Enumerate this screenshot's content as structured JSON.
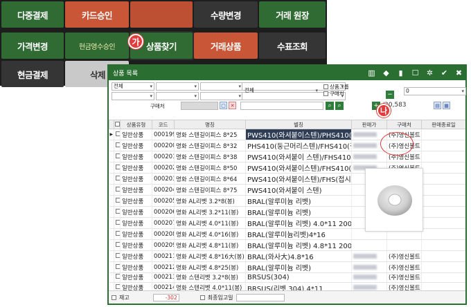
{
  "pos_buttons": [
    {
      "label": "다중결제"
    },
    {
      "label": "카드승인"
    },
    {
      "label": ""
    },
    {
      "label": "수량변경"
    },
    {
      "label": "거래 원장"
    },
    {
      "label": "가격변경"
    },
    {
      "label": "현금영수승인"
    },
    {
      "label": "상품찾기"
    },
    {
      "label": "거래상품"
    },
    {
      "label": "수표조회"
    },
    {
      "label": "현금결제"
    },
    {
      "label": "삭제"
    }
  ],
  "markers": {
    "ga": "가",
    "na": "나"
  },
  "window": {
    "title": "상품 목록",
    "toolbar_icons": [
      "barcode-icon",
      "tag-icon",
      "chart-icon",
      "edit-icon",
      "settings-icon",
      "check-icon",
      "close-icon"
    ]
  },
  "filters": {
    "select1": "전체",
    "select_mid": "전체",
    "category_checkbox": "상품그룹",
    "buyer_checkbox": "구매처",
    "buyer_label": "구매처",
    "qty_select": "0",
    "counter": "/30,583",
    "plus": "+",
    "minus": "−"
  },
  "table": {
    "headers": [
      "",
      "",
      "상품유형",
      "코드",
      "명칭",
      "별칭",
      "판매가",
      "구매처",
      "판매종료일"
    ],
    "rows": [
      {
        "type": "일반상품",
        "code": "000199",
        "name": "명화 스텐길이피스 8*25",
        "spec": "PWS410(와셔붙이스텐)/PHS410(둥근",
        "buyer": "(주)영신볼트"
      },
      {
        "type": "일반상품",
        "code": "000200",
        "name": "명화 스텐길이피스 8*32",
        "spec": "PHS410(둥근머리스텐)/FHS410(접시",
        "buyer": "(주)영신볼트"
      },
      {
        "type": "일반상품",
        "code": "000201",
        "name": "명화 스텐길이피스 8*38",
        "spec": "PWS410(와셔붙이 스텐)/FHS410(접시",
        "buyer": "(주)영신볼트"
      },
      {
        "type": "일반상품",
        "code": "000202",
        "name": "명화 스텐길이피스 8*50",
        "spec": "PWS410(와셔붙이스텐)/FHS410(접시",
        "buyer": "(주)영신볼트"
      },
      {
        "type": "일반상품",
        "code": "000203",
        "name": "명화 스텐길이피스 8*64",
        "spec": "PWS410(와셔붙이스텐)/FHS(접시머리",
        "buyer": ""
      },
      {
        "type": "일반상품",
        "code": "000204",
        "name": "명화 스텐길이피스 8*75",
        "spec": "PWS410(와셔붙이 스텐)",
        "buyer": ""
      },
      {
        "type": "일반상품",
        "code": "000205",
        "name": "명화 AL리벳 3.2*8(봉)",
        "spec": "BRAL(알루미늄 리벳)",
        "buyer": ""
      },
      {
        "type": "일반상품",
        "code": "000206",
        "name": "명화 AL리벳 3.2*11(봉)",
        "spec": "BRAL(알루미늄 리벳)",
        "buyer": ""
      },
      {
        "type": "일반상품",
        "code": "000207",
        "name": "명화 AL리벳 4.0*11(봉)",
        "spec": "BRAL(알루미늄 리벳) 4.0*11 200개",
        "buyer": ""
      },
      {
        "type": "일반상품",
        "code": "000208",
        "name": "명화 AL리벳 4.0*16(봉)",
        "spec": "BRAL(알루미늄리벳)4*16",
        "buyer": ""
      },
      {
        "type": "일반상품",
        "code": "000209",
        "name": "명화 AL리벳 4.8*11(봉)",
        "spec": "BRAL(알루미늄 리벳) 4.8*11 200개",
        "buyer": ""
      },
      {
        "type": "일반상품",
        "code": "000211",
        "name": "명화 AL리벳 4.8*16大(봉)",
        "spec": "BRAL(와사大)4.8*16",
        "buyer": "(주)영신볼트"
      },
      {
        "type": "일반상품",
        "code": "000212",
        "name": "명화 AL리벳 4.8*25(봉)",
        "spec": "BRAL(알루미늄 리벳)",
        "buyer": "(주)영신볼트"
      },
      {
        "type": "일반상품",
        "code": "000213",
        "name": "명화 스텐리벳 3.2*8(봉)",
        "spec": "BRSUS(304)",
        "buyer": "(주)영신볼트"
      },
      {
        "type": "일반상품",
        "code": "000214",
        "name": "명화 스텐리벳 4.0*11(봉)",
        "spec": "BRSUS(리벳 304) 4*11",
        "buyer": "(주)영신볼트"
      },
      {
        "type": "일반상품",
        "code": "000215",
        "name": "명화 스텐리벳 4.8*16(봉)",
        "spec": "BRSUS(리벳 스텐304)",
        "buyer": "(주)영신볼트"
      }
    ]
  },
  "status": {
    "stock_label": "재고",
    "stock_value": "-302",
    "last_in_label": "최종입고일"
  },
  "colors": {
    "green": "#2a6f31",
    "red": "#c85637",
    "marker": "#e23c3c"
  }
}
